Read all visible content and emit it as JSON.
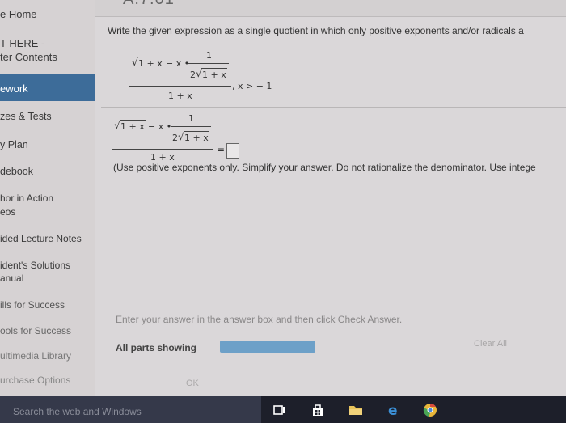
{
  "sidebar": {
    "items": [
      {
        "label": "e Home"
      },
      {
        "label": "T HERE -"
      },
      {
        "label": "ter Contents"
      },
      {
        "label": "ework"
      },
      {
        "label": "zes & Tests"
      },
      {
        "label": "y Plan"
      },
      {
        "label": "debook"
      },
      {
        "label": "hor in Action"
      },
      {
        "label": "eos"
      },
      {
        "label": "ided Lecture Notes"
      },
      {
        "label": "ident's Solutions"
      },
      {
        "label": "anual"
      },
      {
        "label": "ills for Success"
      },
      {
        "label": "ools for Success"
      },
      {
        "label": "ultimedia Library"
      },
      {
        "label": "urchase Options"
      }
    ]
  },
  "header": {
    "title_fragment": "A.7.01"
  },
  "question": {
    "instruction": "Write the given expression as a single quotient in which only positive exponents and/or radicals a",
    "expr": {
      "sqrt_arg": "1 + x",
      "minus_x": "− x •",
      "frac_one": "1",
      "frac_den_coef": "2",
      "frac_den_arg": "1 + x",
      "denominator": "1 + x",
      "condition": ", x > − 1"
    },
    "answer": {
      "equals": "=",
      "note": "(Use positive exponents only. Simplify your answer. Do not rationalize the denominator. Use intege"
    }
  },
  "footer": {
    "hint": "Enter your answer in the answer box and then click Check Answer.",
    "parts_label": "All parts showing",
    "clear_all": "Clear All",
    "ok": "OK"
  },
  "taskbar": {
    "search_placeholder": "Search the web and Windows",
    "icons": [
      "task-view-icon",
      "store-icon",
      "file-explorer-icon",
      "edge-icon",
      "chrome-icon"
    ]
  },
  "colors": {
    "active_nav": "#3d6c99",
    "progress": "#6da0c8",
    "taskbar": "#1d1f2a"
  }
}
